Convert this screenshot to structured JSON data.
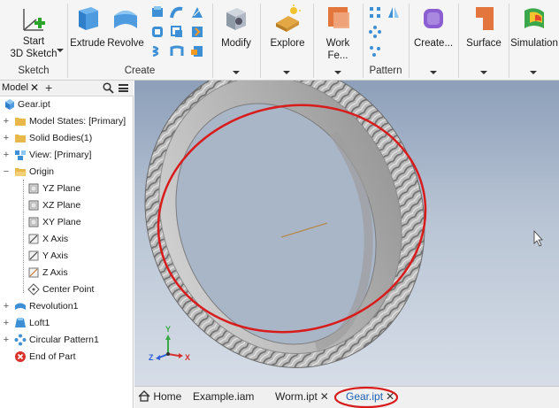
{
  "ribbon": {
    "start_3d_sketch": "Start\n3D Sketch",
    "start_line1": "Start",
    "start_line2": "3D Sketch",
    "group_sketch": "Sketch",
    "extrude": "Extrude",
    "revolve": "Revolve",
    "group_create": "Create",
    "modify": "Modify",
    "explore": "Explore",
    "work_features": "Work Fe...",
    "group_pattern": "Pattern",
    "create_more": "Create...",
    "surface": "Surface",
    "simulation": "Simulation"
  },
  "browser": {
    "tab_label": "Model",
    "close_glyph": "✕",
    "plus_glyph": "+",
    "items": [
      {
        "label": "Gear.ipt"
      },
      {
        "label": "Model States: [Primary]"
      },
      {
        "label": "Solid Bodies(1)"
      },
      {
        "label": "View: [Primary]"
      },
      {
        "label": "Origin"
      },
      {
        "label": "YZ Plane"
      },
      {
        "label": "XZ Plane"
      },
      {
        "label": "XY Plane"
      },
      {
        "label": "X Axis"
      },
      {
        "label": "Y Axis"
      },
      {
        "label": "Z Axis"
      },
      {
        "label": "Center Point"
      },
      {
        "label": "Revolution1"
      },
      {
        "label": "Loft1"
      },
      {
        "label": "Circular Pattern1"
      },
      {
        "label": "End of Part"
      }
    ]
  },
  "triad": {
    "y": "Y",
    "z": "Z",
    "x": "X"
  },
  "doc_tabs": {
    "home": "Home",
    "tab1": "Example.iam",
    "tab2": "Worm.ipt",
    "tab3": "Gear.ipt",
    "close_glyph": "✕"
  },
  "colors": {
    "accent": "#1b5fb4",
    "annotation_red": "#d81b1b",
    "folder_yellow": "#e8b84a",
    "part_blue": "#3d8fd6"
  }
}
